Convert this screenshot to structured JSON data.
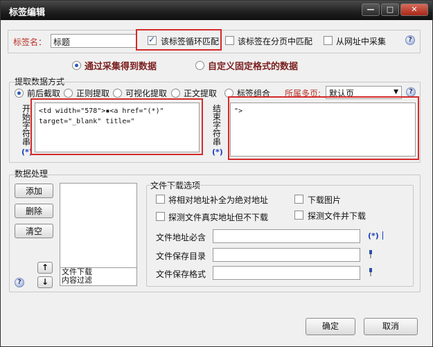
{
  "window": {
    "title": "标签编辑",
    "minimize": "—",
    "maximize": "□",
    "close": "✕"
  },
  "tag_name": {
    "label": "标签名：",
    "value": "标题"
  },
  "options_top": {
    "loop_match": "该标签循环匹配",
    "paging_match": "该标签在分页中匹配",
    "url_collect": "从网址中采集"
  },
  "source_mode": {
    "collect": "通过采集得到数据",
    "custom": "自定义固定格式的数据"
  },
  "extract": {
    "section_title": "提取数据方式",
    "methods": [
      "前后截取",
      "正则提取",
      "可视化提取",
      "正文提取",
      "标签组合"
    ],
    "multi_page_label": "所属多页:",
    "multi_page_value": "默认页"
  },
  "start_string": {
    "label": "开始字符串",
    "value": "<td width=\"578\">▪<a href=\"(*)\"\ntarget=\"_blank\" title=\"",
    "wildcard": "(*)"
  },
  "end_string": {
    "label": "结束字符串",
    "value": "\">",
    "wildcard": "(*)"
  },
  "data_processing": {
    "section_title": "数据处理",
    "add": "添加",
    "delete": "删除",
    "clear": "清空",
    "up": "↑",
    "down": "↓",
    "list_items": [
      "文件下载",
      "内容过滤"
    ]
  },
  "file_download": {
    "section_title": "文件下载选项",
    "relative_to_absolute": "将相对地址补全为绝对地址",
    "download_images": "下载图片",
    "detect_real_no_download": "探测文件真实地址但不下载",
    "detect_and_download": "探测文件并下载",
    "url_must_contain": "文件地址必含",
    "save_dir": "文件保存目录",
    "save_format": "文件保存格式",
    "wildcard": "(*)"
  },
  "buttons": {
    "ok": "确定",
    "cancel": "取消"
  },
  "icons": {
    "help": "help-question-icon",
    "pin": "pin-icon"
  }
}
